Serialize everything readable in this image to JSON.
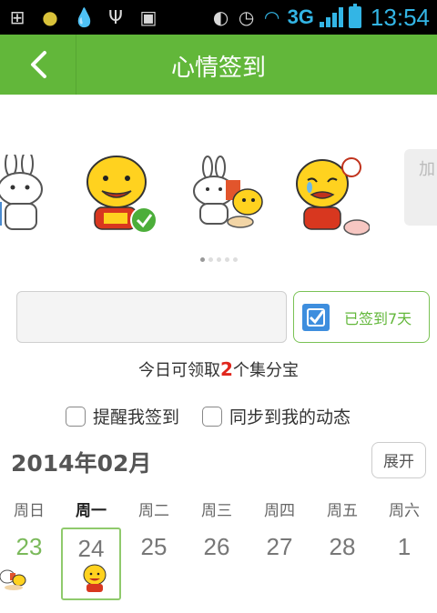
{
  "status_bar": {
    "network": "3G",
    "time": "13:54",
    "icons": [
      "add-icon",
      "chrome-icon",
      "drop-icon",
      "usb-icon",
      "android-icon",
      "vibrate-icon",
      "alarm-icon",
      "wifi-icon"
    ]
  },
  "header": {
    "title": "心情签到",
    "back_icon": "chevron-left-icon"
  },
  "carousel": {
    "stickers": [
      "rabbit",
      "yellow-face-selected",
      "rabbit-and-duck",
      "crying-face"
    ],
    "side_button": "加",
    "pages": 5,
    "active_page": 0
  },
  "sign_in": {
    "button_label": "已签到7天",
    "reward_prefix": "今日可领取",
    "reward_count": "2",
    "reward_suffix": "个集分宝"
  },
  "options": {
    "remind_label": "提醒我签到",
    "sync_label": "同步到我的动态"
  },
  "calendar": {
    "title": "2014年02月",
    "expand_label": "展开",
    "weekdays": [
      "周日",
      "周一",
      "周二",
      "周三",
      "周四",
      "周五",
      "周六"
    ],
    "days": [
      "23",
      "24",
      "25",
      "26",
      "27",
      "28",
      "1"
    ],
    "today_index": 1,
    "signed_index": 0
  },
  "colors": {
    "accent": "#62b73a",
    "reward_red": "#e0261d",
    "status_blue": "#33b5e5"
  }
}
